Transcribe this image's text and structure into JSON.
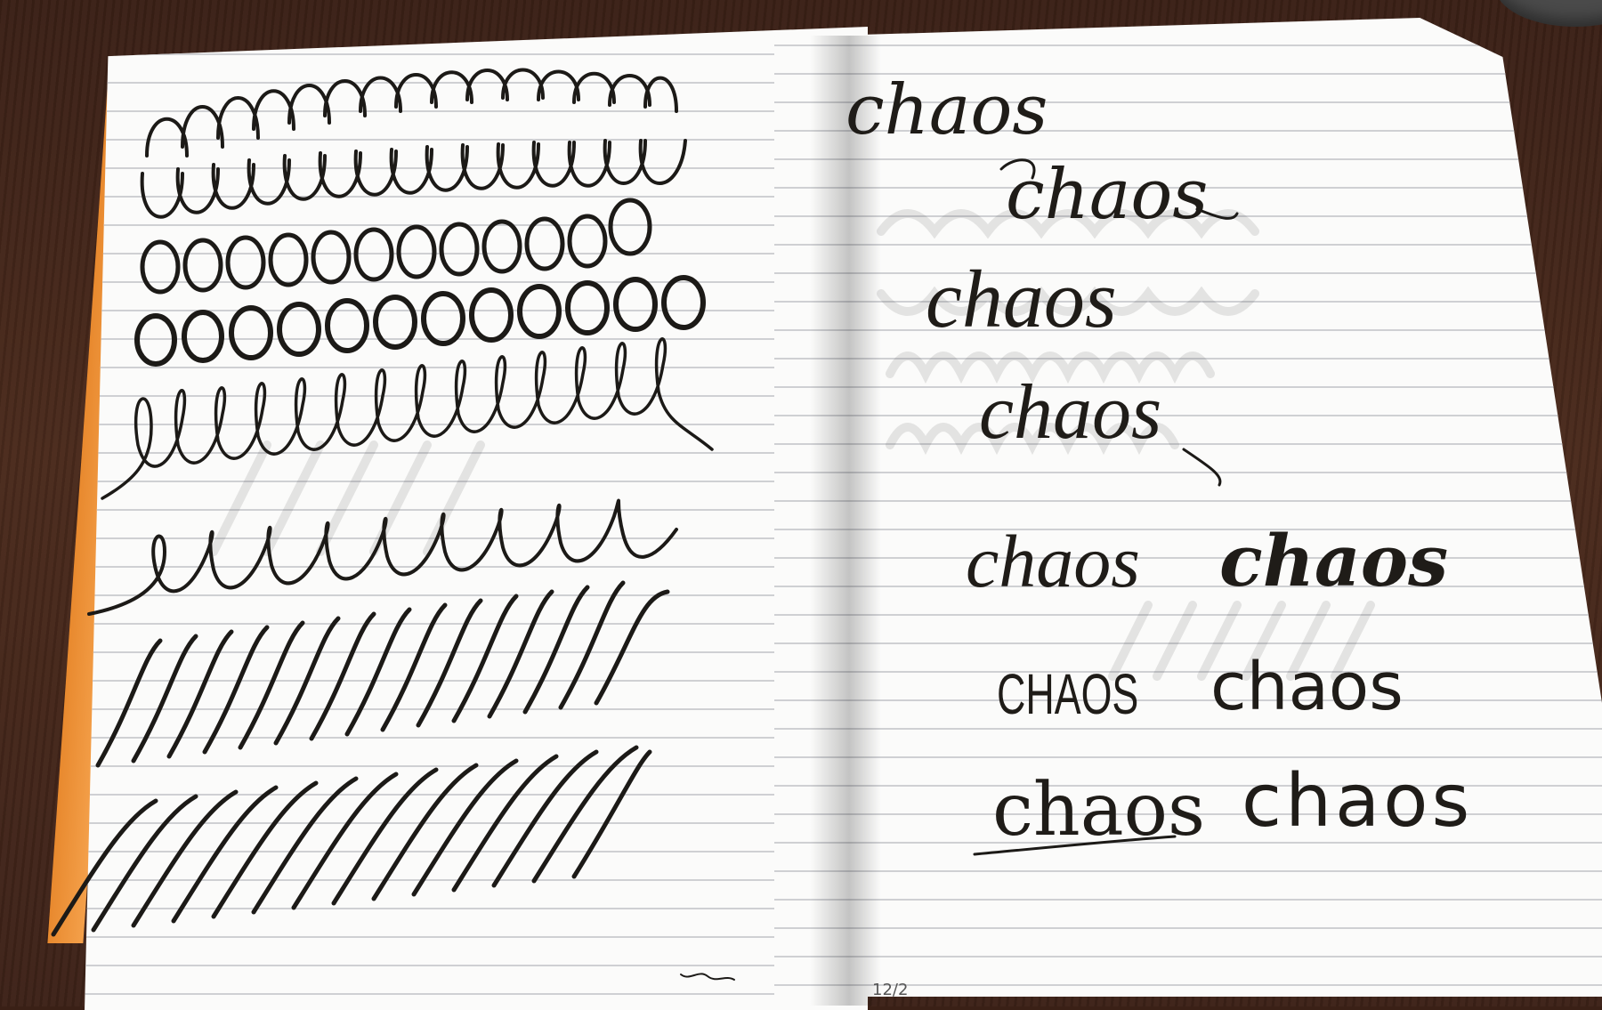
{
  "scene": "open lined notebook with calligraphy practice strokes",
  "right_page": {
    "words": [
      "chaos",
      "chaos",
      "chaos",
      "chaos",
      "chaos",
      "chaos",
      "CHAOS",
      "chaos",
      "chaos",
      "chaos"
    ]
  },
  "bottom_note": "12/2"
}
